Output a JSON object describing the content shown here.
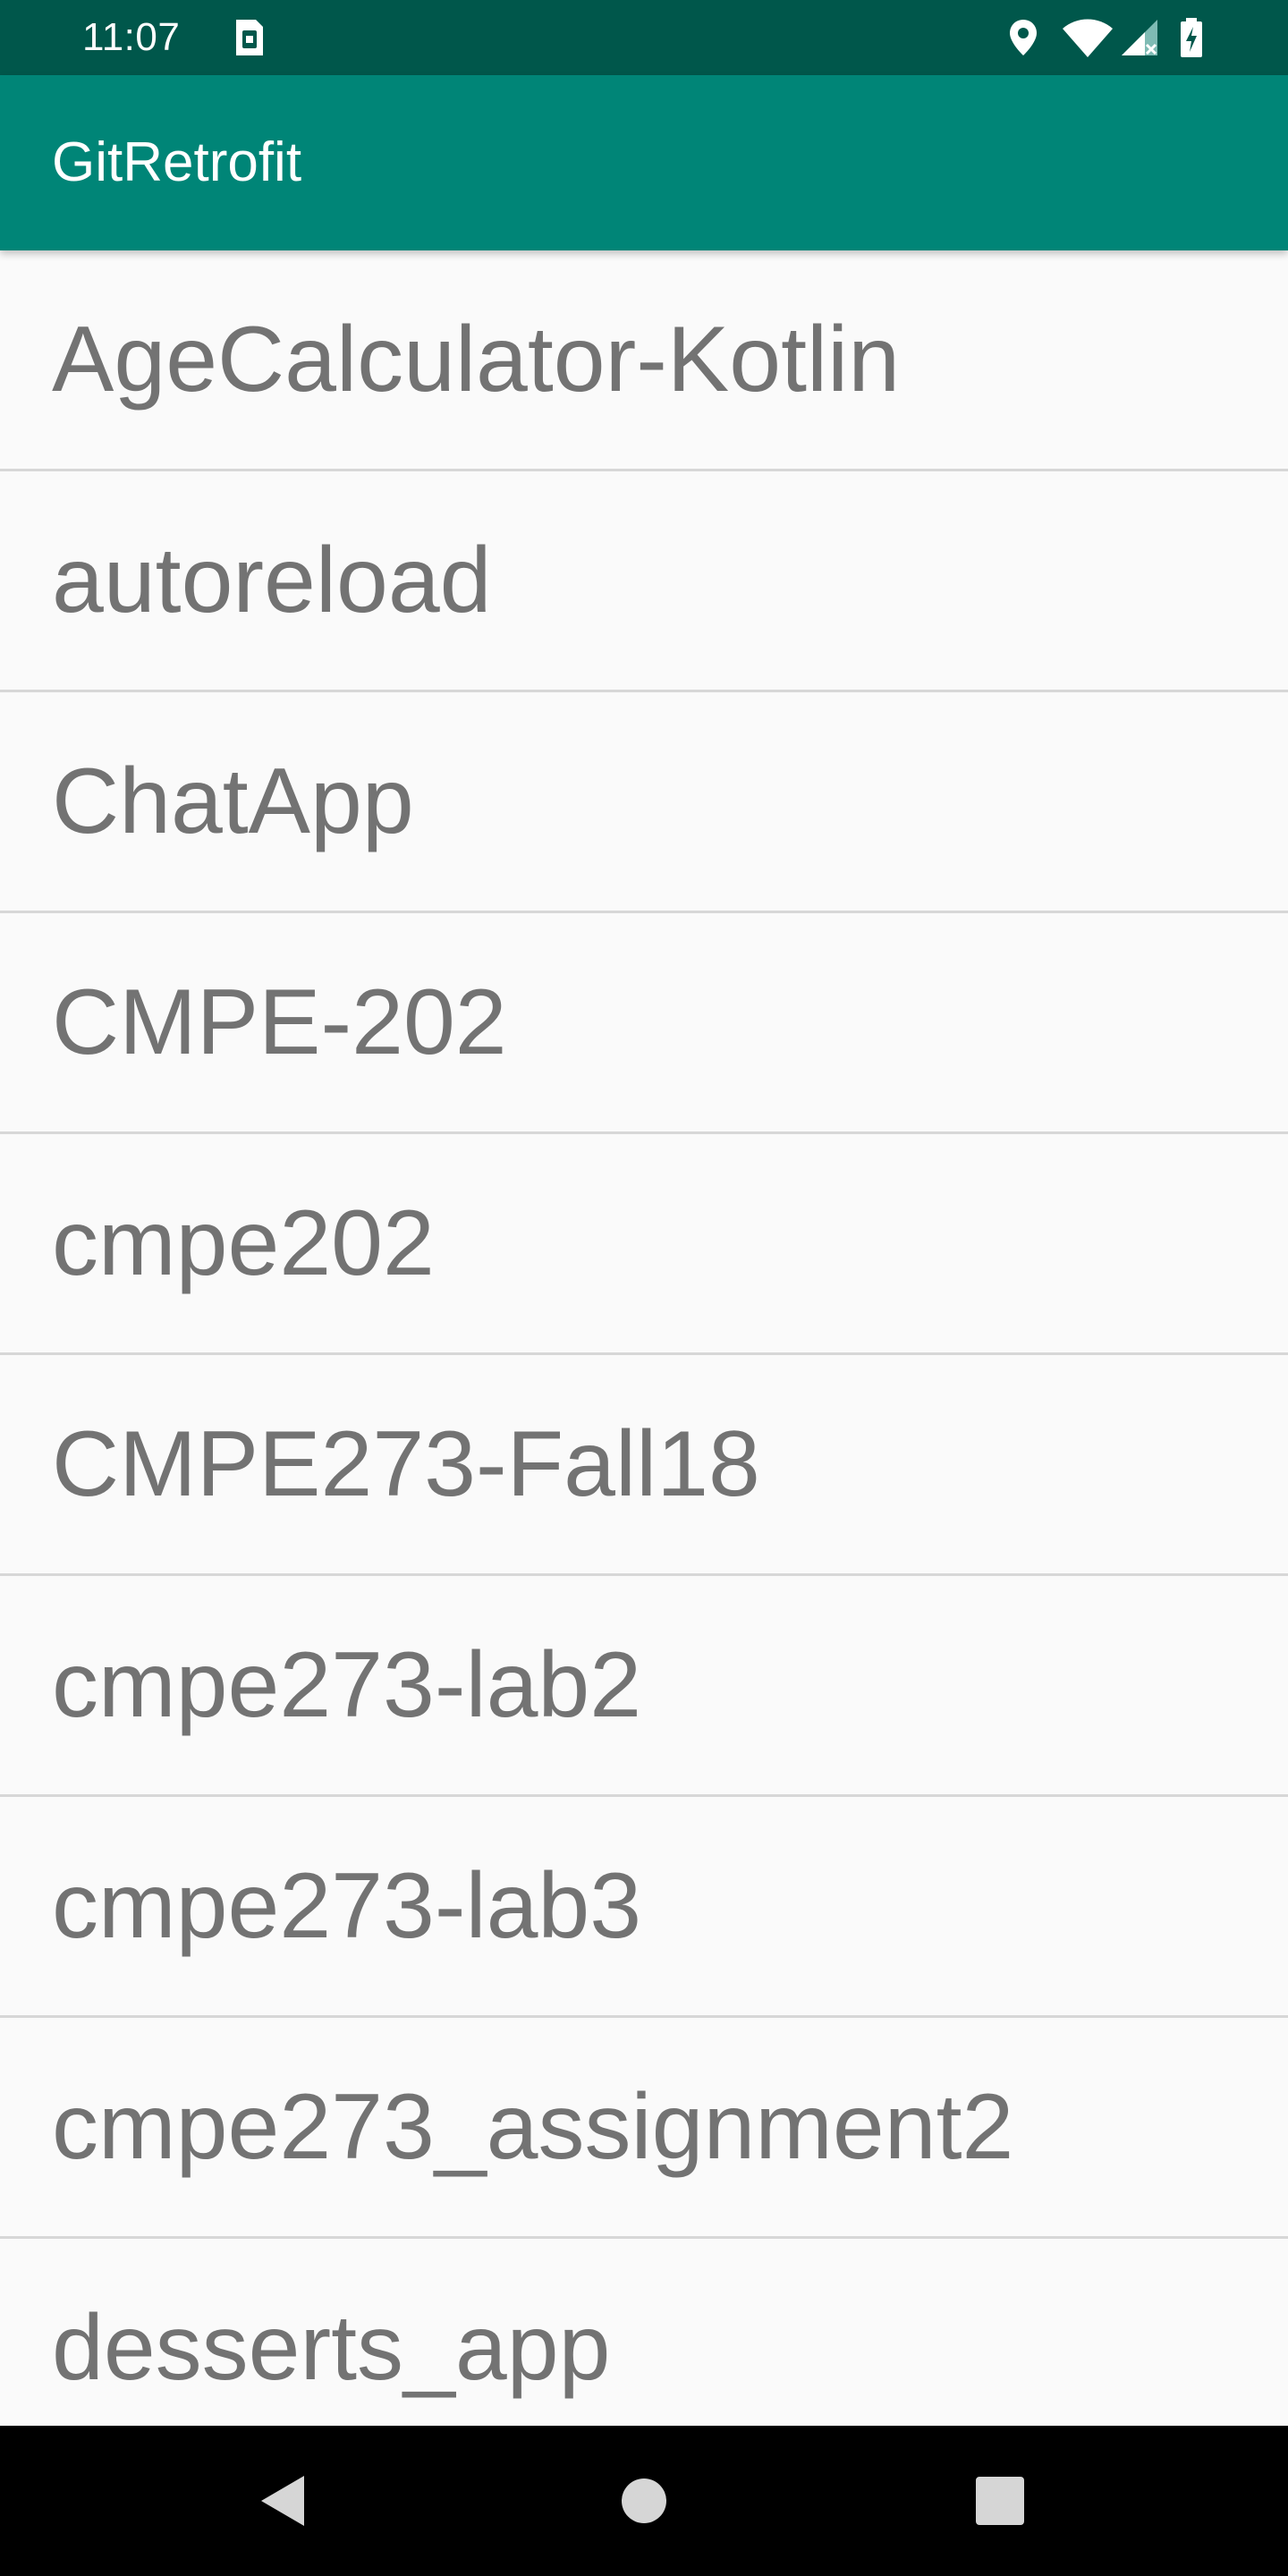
{
  "status_bar": {
    "time": "11:07",
    "icons": [
      "sim-card-icon",
      "location-icon",
      "wifi-icon",
      "cell-signal-icon",
      "battery-charging-icon"
    ]
  },
  "app_bar": {
    "title": "GitRetrofit",
    "color": "#008577",
    "status_color": "#00574b"
  },
  "repositories": [
    {
      "name": "AgeCalculator-Kotlin"
    },
    {
      "name": "autoreload"
    },
    {
      "name": "ChatApp"
    },
    {
      "name": "CMPE-202"
    },
    {
      "name": "cmpe202"
    },
    {
      "name": "CMPE273-Fall18"
    },
    {
      "name": "cmpe273-lab2"
    },
    {
      "name": "cmpe273-lab3"
    },
    {
      "name": "cmpe273_assignment2"
    },
    {
      "name": "desserts_app"
    }
  ],
  "nav_bar": {
    "buttons": [
      "back-icon",
      "home-icon",
      "recents-icon"
    ]
  }
}
